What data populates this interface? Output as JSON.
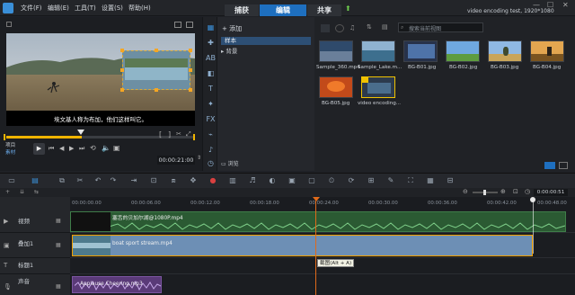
{
  "menu": [
    "文件(F)",
    "编辑(E)",
    "工具(T)",
    "设置(S)",
    "帮助(H)"
  ],
  "workspace_tabs": [
    "捕获",
    "编辑",
    "共享"
  ],
  "project_info": "video encoding test, 1920*1080",
  "subtitle_text": "埃文基人称为布加，他们这样叫它。",
  "player": {
    "mode_top": "项目",
    "mode_bottom": "素材",
    "timecode": "00:00:21:00"
  },
  "library": {
    "add_label": "添加",
    "folders": [
      "样本",
      "背景"
    ],
    "search_placeholder": "搜索当前视图",
    "browse_label": "浏览",
    "items": [
      {
        "name": "Sample_360.mp4"
      },
      {
        "name": "Sample_Lake.m..."
      },
      {
        "name": "BG-B01.jpg"
      },
      {
        "name": "BG-B02.jpg"
      },
      {
        "name": "BG-B03.jpg"
      },
      {
        "name": "BG-B04.jpg"
      },
      {
        "name": "BG-B05.jpg"
      },
      {
        "name": "video encoding..."
      }
    ]
  },
  "ruler_ticks": [
    "00:00:00.00",
    "00:00:06.00",
    "00:00:12.00",
    "00:00:18.00",
    "00:00:24.00",
    "00:00:30.00",
    "00:00:36.00",
    "00:00:42.00",
    "00:00:48.00"
  ],
  "timeline": {
    "zoom_time": "0:00:00:51",
    "tracks": [
      {
        "name": "视频"
      },
      {
        "name": "叠加1"
      },
      {
        "name": "标题1"
      },
      {
        "name": "声音"
      }
    ],
    "clips": {
      "video": "塞舌的贝加尔湖@1080P.mp4",
      "overlay": "boat sport stream.mp4",
      "voice": "Applause Cheering.mp3"
    },
    "playhead_tooltip": "截图(Alt + A)"
  }
}
